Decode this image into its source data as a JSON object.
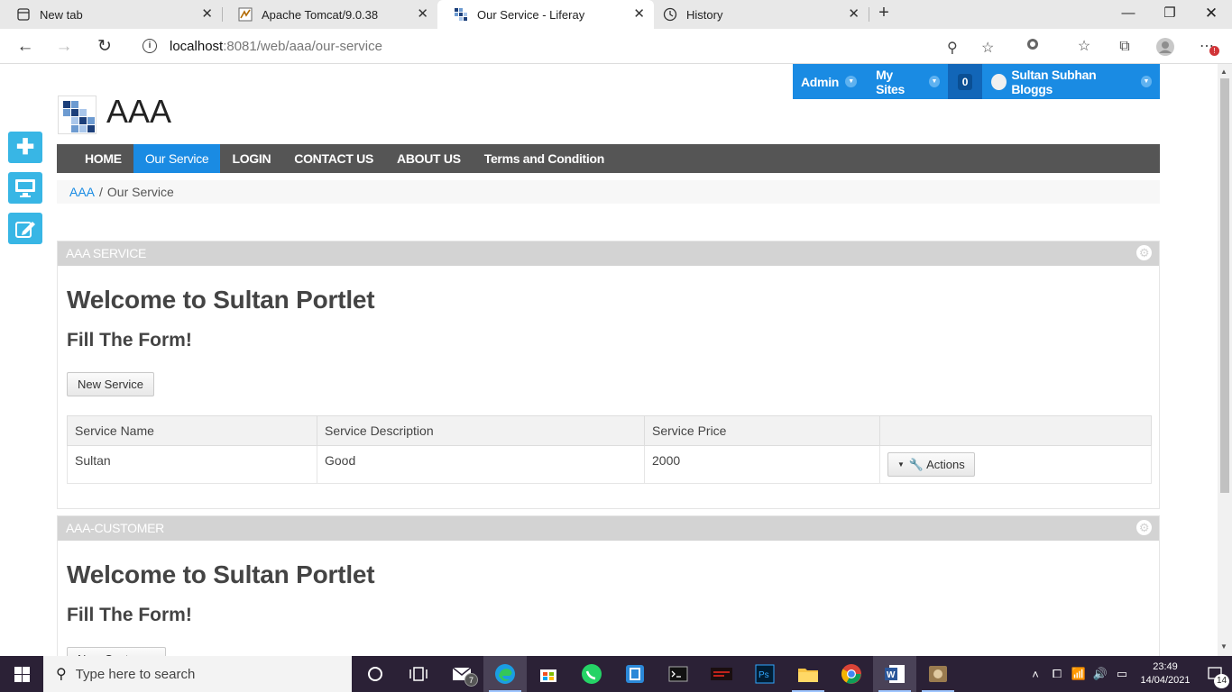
{
  "browser": {
    "tabs": [
      {
        "title": "New tab",
        "icon": "new-tab-icon",
        "active": false
      },
      {
        "title": "Apache Tomcat/9.0.38",
        "icon": "tomcat-icon",
        "active": false
      },
      {
        "title": "Our Service - Liferay",
        "icon": "liferay-icon",
        "active": true
      },
      {
        "title": "History",
        "icon": "history-icon",
        "active": false
      }
    ],
    "url_host": "localhost",
    "url_rest": ":8081/web/aaa/our-service"
  },
  "dockbar": {
    "admin": "Admin",
    "my_sites": "My Sites",
    "notifications": "0",
    "user": "Sultan Subhan Bloggs"
  },
  "site": {
    "title": "AAA",
    "nav": [
      "HOME",
      "Our Service",
      "LOGIN",
      "CONTACT US",
      "ABOUT US",
      "Terms and Condition"
    ],
    "active_nav": "Our Service",
    "breadcrumb": {
      "root": "AAA",
      "separator": "/",
      "current": "Our Service"
    }
  },
  "portlets": [
    {
      "title": "AAA SERVICE",
      "heading": "Welcome to Sultan Portlet",
      "subheading": "Fill The Form!",
      "button": "New Service",
      "table": {
        "headers": [
          "Service Name",
          "Service Description",
          "Service Price",
          ""
        ],
        "rows": [
          {
            "name": "Sultan",
            "description": "Good",
            "price": "2000",
            "action": "Actions"
          }
        ]
      }
    },
    {
      "title": "AAA-CUSTOMER",
      "heading": "Welcome to Sultan Portlet",
      "subheading": "Fill The Form!",
      "button": "New Customer"
    }
  ],
  "taskbar": {
    "search_placeholder": "Type here to search",
    "time": "23:49",
    "date": "14/04/2021",
    "mail_badge": "7",
    "notification_count": "14"
  },
  "colors": {
    "accent": "#1a8be3",
    "navbar": "#555555",
    "side_tool": "#38b6e5"
  }
}
